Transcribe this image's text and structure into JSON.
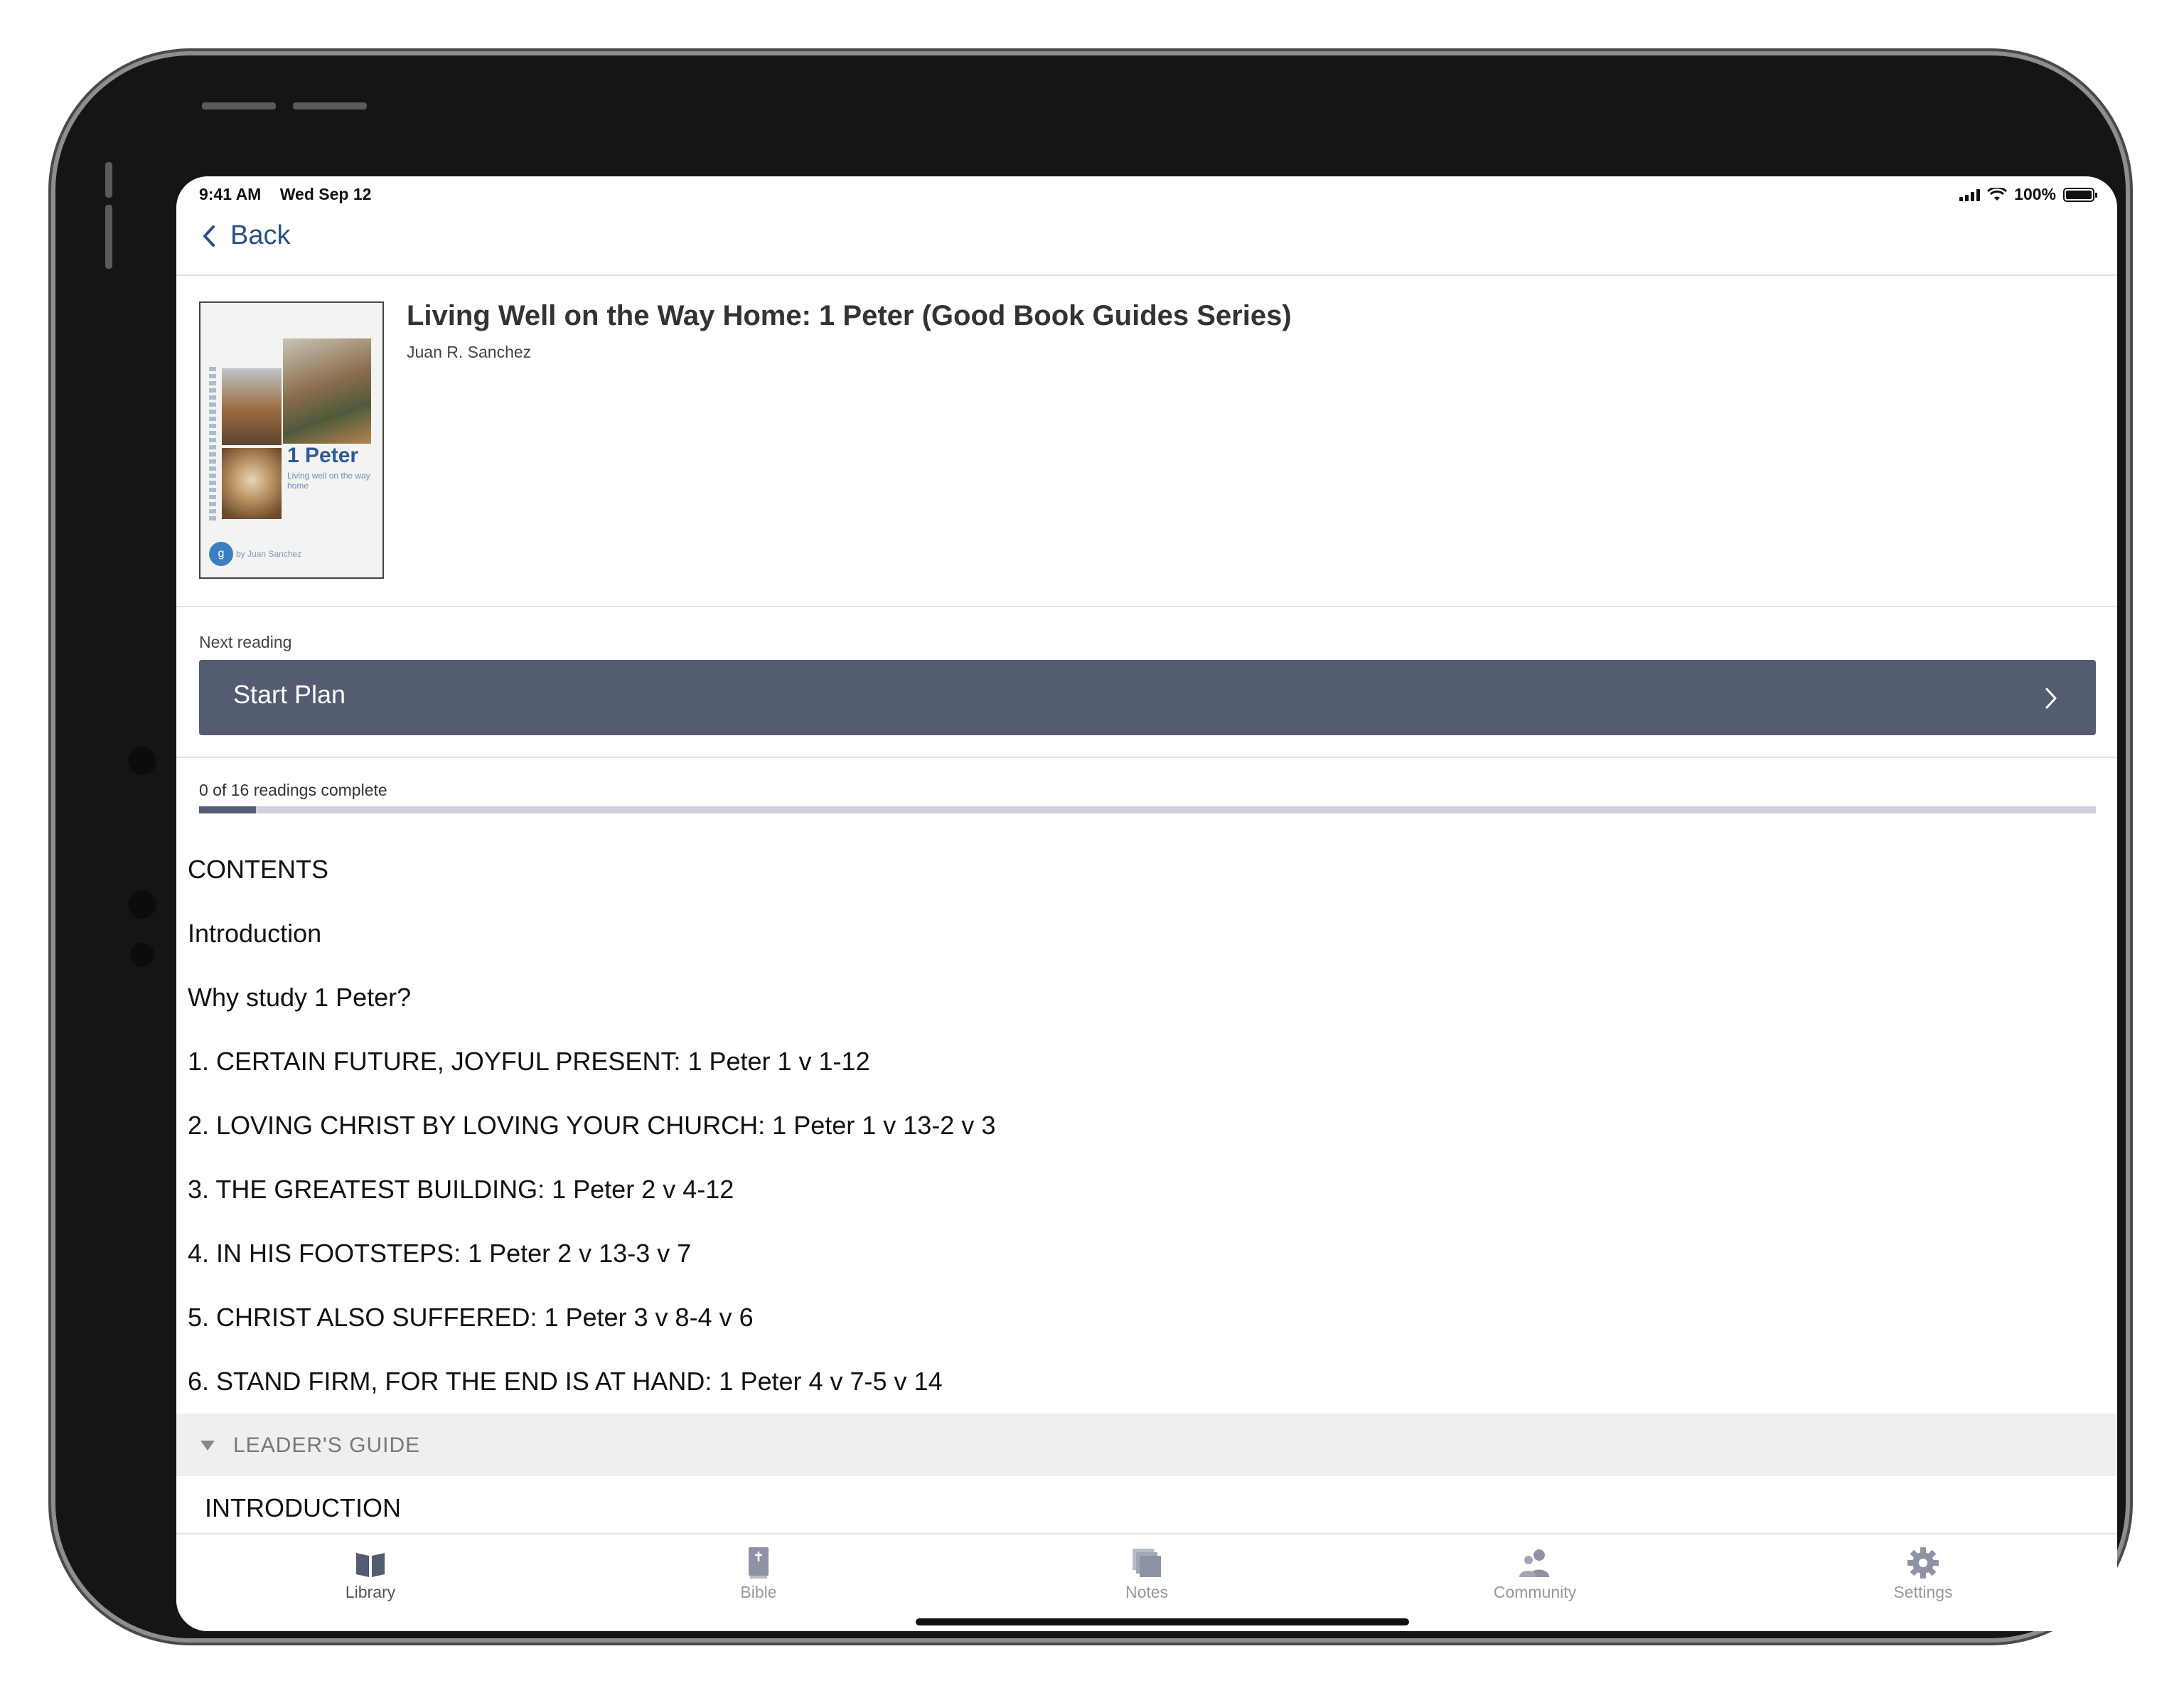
{
  "status_bar": {
    "time": "9:41 AM",
    "date": "Wed Sep 12",
    "battery": "100%"
  },
  "nav": {
    "back_label": "Back"
  },
  "book": {
    "title": "Living Well on the Way Home: 1 Peter (Good Book Guides Series)",
    "author": "Juan R. Sanchez",
    "cover": {
      "title": "1 Peter",
      "subtitle": "Living well on the way home",
      "author": "by Juan Sanchez"
    }
  },
  "next_reading": {
    "label": "Next reading",
    "button_label": "Start Plan"
  },
  "progress": {
    "text": "0 of 16 readings complete",
    "fraction": 0.03
  },
  "contents": {
    "items": [
      "CONTENTS",
      "Introduction",
      "Why study 1 Peter?",
      "1. CERTAIN FUTURE, JOYFUL PRESENT: 1 Peter 1 v 1-12",
      "2. LOVING CHRIST BY LOVING YOUR CHURCH: 1 Peter 1 v 13-2 v 3",
      "3. THE GREATEST BUILDING: 1 Peter 2 v 4-12",
      "4. IN HIS FOOTSTEPS: 1 Peter 2 v 13-3 v 7",
      "5. CHRIST ALSO SUFFERED: 1 Peter 3 v 8-4 v 6",
      "6. STAND FIRM, FOR THE END IS AT HAND: 1 Peter 4 v 7-5 v 14"
    ]
  },
  "leaders_guide": {
    "label": "LEADER'S GUIDE",
    "first_item": "INTRODUCTION"
  },
  "tabs": [
    {
      "label": "Library",
      "icon": "book-icon",
      "active": true
    },
    {
      "label": "Bible",
      "icon": "bible-icon",
      "active": false
    },
    {
      "label": "Notes",
      "icon": "notes-icon",
      "active": false
    },
    {
      "label": "Community",
      "icon": "people-icon",
      "active": false
    },
    {
      "label": "Settings",
      "icon": "gear-icon",
      "active": false
    }
  ],
  "colors": {
    "accent": "#545c72",
    "link": "#2b4f86",
    "progress_track": "#cdd2db"
  }
}
